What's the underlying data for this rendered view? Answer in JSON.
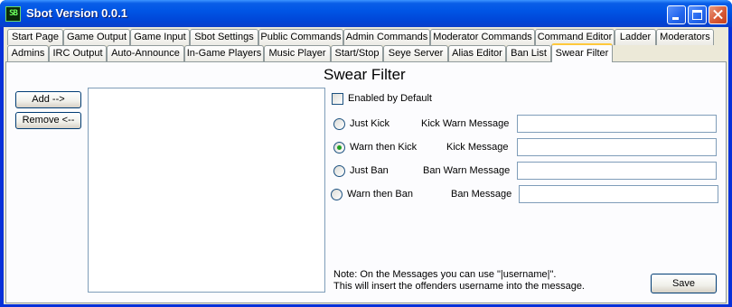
{
  "window": {
    "title": "Sbot Version 0.0.1",
    "icon": "SB",
    "controls": [
      "minimize-icon",
      "maximize-icon",
      "close-icon"
    ]
  },
  "tabs": {
    "row1": [
      "Start Page",
      "Game Output",
      "Game Input",
      "Sbot Settings",
      "Public Commands",
      "Admin Commands",
      "Moderator Commands",
      "Command Editor",
      "Ladder",
      "Moderators"
    ],
    "row2": [
      "Admins",
      "IRC Output",
      "Auto-Announce",
      "In-Game Players",
      "Music Player",
      "Start/Stop",
      "Seye Server",
      "Alias Editor",
      "Ban List",
      "Swear Filter"
    ],
    "active": "Swear Filter"
  },
  "panel": {
    "heading": "Swear Filter",
    "add_label": "Add -->",
    "remove_label": "Remove <--",
    "enabled_label": "Enabled by Default",
    "enabled_checked": false,
    "options": [
      {
        "label": "Just Kick",
        "checked": false,
        "field_label": "Kick Warn Message",
        "field_value": ""
      },
      {
        "label": "Warn then Kick",
        "checked": true,
        "field_label": "Kick Message",
        "field_value": ""
      },
      {
        "label": "Just Ban",
        "checked": false,
        "field_label": "Ban Warn Message",
        "field_value": ""
      },
      {
        "label": "Warn then Ban",
        "checked": false,
        "field_label": "Ban Message",
        "field_value": ""
      }
    ],
    "note_line1": "Note: On the Messages you can use \"|username|\".",
    "note_line2": "This will insert the offenders username into the message.",
    "save_label": "Save"
  },
  "colors": {
    "titlebar": "#0055e5",
    "face": "#ece9d8",
    "active_tab_highlight": "#ffc83c",
    "radio_dot": "#21a121"
  }
}
